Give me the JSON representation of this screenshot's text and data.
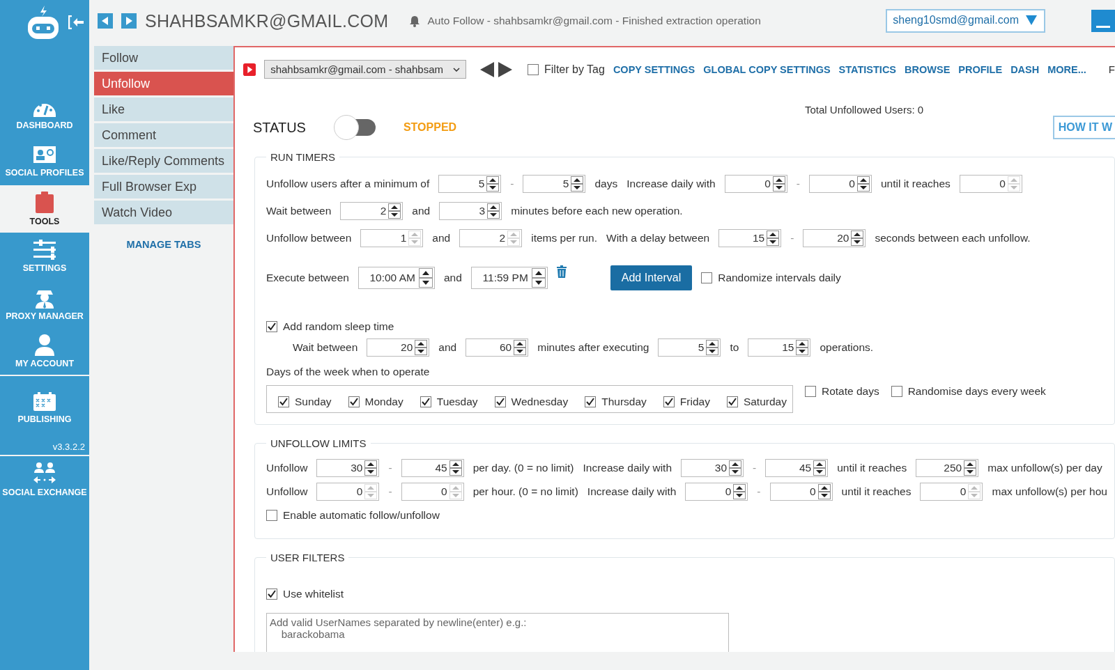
{
  "sidebar": {
    "groups": [
      {
        "items": [
          {
            "kind": "dashboard",
            "label": "DASHBOARD",
            "selected": false
          },
          {
            "kind": "profiles",
            "label": "SOCIAL PROFILES",
            "selected": false
          },
          {
            "kind": "tools",
            "label": "TOOLS",
            "selected": true
          },
          {
            "kind": "settings",
            "label": "SETTINGS",
            "selected": false
          },
          {
            "kind": "proxy",
            "label": "PROXY MANAGER",
            "selected": false
          },
          {
            "kind": "account",
            "label": "MY ACCOUNT",
            "selected": false
          }
        ]
      },
      {
        "items": [
          {
            "kind": "publishing",
            "label": "PUBLISHING",
            "selected": false
          }
        ],
        "version": "v3.3.2.2"
      },
      {
        "items": [
          {
            "kind": "exchange",
            "label": "SOCIAL EXCHANGE",
            "selected": false
          }
        ]
      }
    ]
  },
  "header": {
    "title": "SHAHBSAMKR@GMAIL.COM",
    "notification": "Auto Follow - shahbsamkr@gmail.com - Finished extraction operation",
    "account": "sheng10smd@gmail.com"
  },
  "tabs": [
    {
      "label": "Follow",
      "selected": false
    },
    {
      "label": "Unfollow",
      "selected": true
    },
    {
      "label": "Like",
      "selected": false
    },
    {
      "label": "Comment",
      "selected": false
    },
    {
      "label": "Like/Reply Comments",
      "selected": false
    },
    {
      "label": "Full Browser Exp",
      "selected": false
    },
    {
      "label": "Watch Video",
      "selected": false
    }
  ],
  "manage_tabs": "MANAGE TABS",
  "toolbar": {
    "account_select": "shahbsamkr@gmail.com - shahbsam",
    "filter_by_tag": {
      "label": "Filter by Tag",
      "checked": false
    },
    "links": [
      "COPY SETTINGS",
      "GLOBAL COPY SETTINGS",
      "STATISTICS",
      "BROWSE",
      "PROFILE",
      "DASH",
      "MORE..."
    ],
    "cut_label": "F"
  },
  "status": {
    "label": "STATUS",
    "on": false,
    "state": "STOPPED",
    "total": "Total Unfollowed Users: 0",
    "how_it_works": "HOW IT W"
  },
  "sections": [
    {
      "title": "RUN TIMERS",
      "rows": [
        {
          "parts": [
            {
              "kind": "text",
              "text": "Unfollow users after a minimum of"
            },
            {
              "kind": "spin",
              "value": "5",
              "disabled": false
            },
            {
              "kind": "dash",
              "text": "-"
            },
            {
              "kind": "spin",
              "value": "5",
              "disabled": false
            },
            {
              "kind": "text",
              "text": "days"
            },
            {
              "kind": "text",
              "text": "Increase daily with"
            },
            {
              "kind": "spin",
              "value": "0",
              "disabled": false
            },
            {
              "kind": "dash",
              "text": "-"
            },
            {
              "kind": "spin",
              "value": "0",
              "disabled": false
            },
            {
              "kind": "text",
              "text": "until it reaches"
            },
            {
              "kind": "spin",
              "value": "0",
              "disabled": true
            }
          ]
        },
        {
          "parts": [
            {
              "kind": "text",
              "text": "Wait between"
            },
            {
              "kind": "spin",
              "value": "2",
              "disabled": false
            },
            {
              "kind": "text",
              "text": "and"
            },
            {
              "kind": "spin",
              "value": "3",
              "disabled": false
            },
            {
              "kind": "text",
              "text": "minutes before each new operation."
            }
          ]
        },
        {
          "parts": [
            {
              "kind": "text",
              "text": "Unfollow between"
            },
            {
              "kind": "spin",
              "value": "1",
              "disabled": true
            },
            {
              "kind": "text",
              "text": "and"
            },
            {
              "kind": "spin",
              "value": "2",
              "disabled": true
            },
            {
              "kind": "text",
              "text": "items per run."
            },
            {
              "kind": "text",
              "text": "With a delay between"
            },
            {
              "kind": "spin",
              "value": "15",
              "disabled": false
            },
            {
              "kind": "dash",
              "text": "-"
            },
            {
              "kind": "spin",
              "value": "20",
              "disabled": false
            },
            {
              "kind": "text",
              "text": "seconds between each unfollow."
            }
          ]
        },
        {
          "parts": [
            {
              "kind": "text",
              "text": "Execute between"
            },
            {
              "kind": "time",
              "value": "10:00 AM"
            },
            {
              "kind": "text",
              "text": "and"
            },
            {
              "kind": "time",
              "value": "11:59 PM"
            },
            {
              "kind": "trash"
            },
            {
              "kind": "button",
              "label": "Add Interval"
            },
            {
              "kind": "check",
              "label": "Randomize intervals daily",
              "checked": false
            }
          ]
        },
        {
          "parts": [
            {
              "kind": "check",
              "label": "Add random sleep time",
              "checked": true
            }
          ],
          "children": [
            {
              "parts": [
                {
                  "kind": "text",
                  "text": "Wait between"
                },
                {
                  "kind": "spin",
                  "value": "20",
                  "disabled": false
                },
                {
                  "kind": "text",
                  "text": "and"
                },
                {
                  "kind": "spin",
                  "value": "60",
                  "disabled": false
                },
                {
                  "kind": "text",
                  "text": "minutes after executing"
                },
                {
                  "kind": "spin",
                  "value": "5",
                  "disabled": false
                },
                {
                  "kind": "text",
                  "text": "to"
                },
                {
                  "kind": "spin",
                  "value": "15",
                  "disabled": false
                },
                {
                  "kind": "text",
                  "text": "operations."
                }
              ]
            }
          ]
        },
        {
          "parts": [
            {
              "kind": "text",
              "text": "Days of the week when to operate"
            }
          ]
        },
        {
          "parts": [
            {
              "kind": "days",
              "items": [
                {
                  "label": "Sunday",
                  "checked": true
                },
                {
                  "label": "Monday",
                  "checked": true
                },
                {
                  "label": "Tuesday",
                  "checked": true
                },
                {
                  "label": "Wednesday",
                  "checked": true
                },
                {
                  "label": "Thursday",
                  "checked": true
                },
                {
                  "label": "Friday",
                  "checked": true
                },
                {
                  "label": "Saturday",
                  "checked": true
                }
              ]
            },
            {
              "kind": "check",
              "label": "Rotate days",
              "checked": false
            },
            {
              "kind": "check",
              "label": "Randomise days every week",
              "checked": false
            }
          ]
        }
      ]
    },
    {
      "title": "UNFOLLOW LIMITS",
      "rows": [
        {
          "parts": [
            {
              "kind": "text",
              "text": "Unfollow"
            },
            {
              "kind": "spin",
              "value": "30",
              "disabled": false
            },
            {
              "kind": "dash",
              "text": "-"
            },
            {
              "kind": "spin",
              "value": "45",
              "disabled": false
            },
            {
              "kind": "text",
              "text": "per day. (0 = no limit)"
            },
            {
              "kind": "text",
              "text": "Increase daily with"
            },
            {
              "kind": "spin",
              "value": "30",
              "disabled": false
            },
            {
              "kind": "dash",
              "text": "-"
            },
            {
              "kind": "spin",
              "value": "45",
              "disabled": false
            },
            {
              "kind": "text",
              "text": "until it reaches"
            },
            {
              "kind": "spin",
              "value": "250",
              "disabled": false
            },
            {
              "kind": "text",
              "text": "max unfollow(s) per day"
            }
          ]
        },
        {
          "parts": [
            {
              "kind": "text",
              "text": "Unfollow"
            },
            {
              "kind": "spin",
              "value": "0",
              "disabled": true
            },
            {
              "kind": "dash",
              "text": "-"
            },
            {
              "kind": "spin",
              "value": "0",
              "disabled": true
            },
            {
              "kind": "text",
              "text": "per hour. (0 = no limit)"
            },
            {
              "kind": "text",
              "text": "Increase daily with"
            },
            {
              "kind": "spin",
              "value": "0",
              "disabled": false
            },
            {
              "kind": "dash",
              "text": "-"
            },
            {
              "kind": "spin",
              "value": "0",
              "disabled": false
            },
            {
              "kind": "text",
              "text": "until it reaches"
            },
            {
              "kind": "spin",
              "value": "0",
              "disabled": true
            },
            {
              "kind": "text",
              "text": "max unfollow(s) per hou"
            }
          ]
        },
        {
          "parts": [
            {
              "kind": "check",
              "label": "Enable automatic follow/unfollow",
              "checked": false
            }
          ]
        }
      ]
    },
    {
      "title": "USER FILTERS",
      "rows": [
        {
          "parts": [
            {
              "kind": "check",
              "label": "Use whitelist",
              "checked": true
            }
          ]
        },
        {
          "parts": [
            {
              "kind": "textarea",
              "placeholder": "Add valid UserNames separated by newline(enter) e.g.:\n    barackobama"
            }
          ]
        }
      ]
    }
  ]
}
